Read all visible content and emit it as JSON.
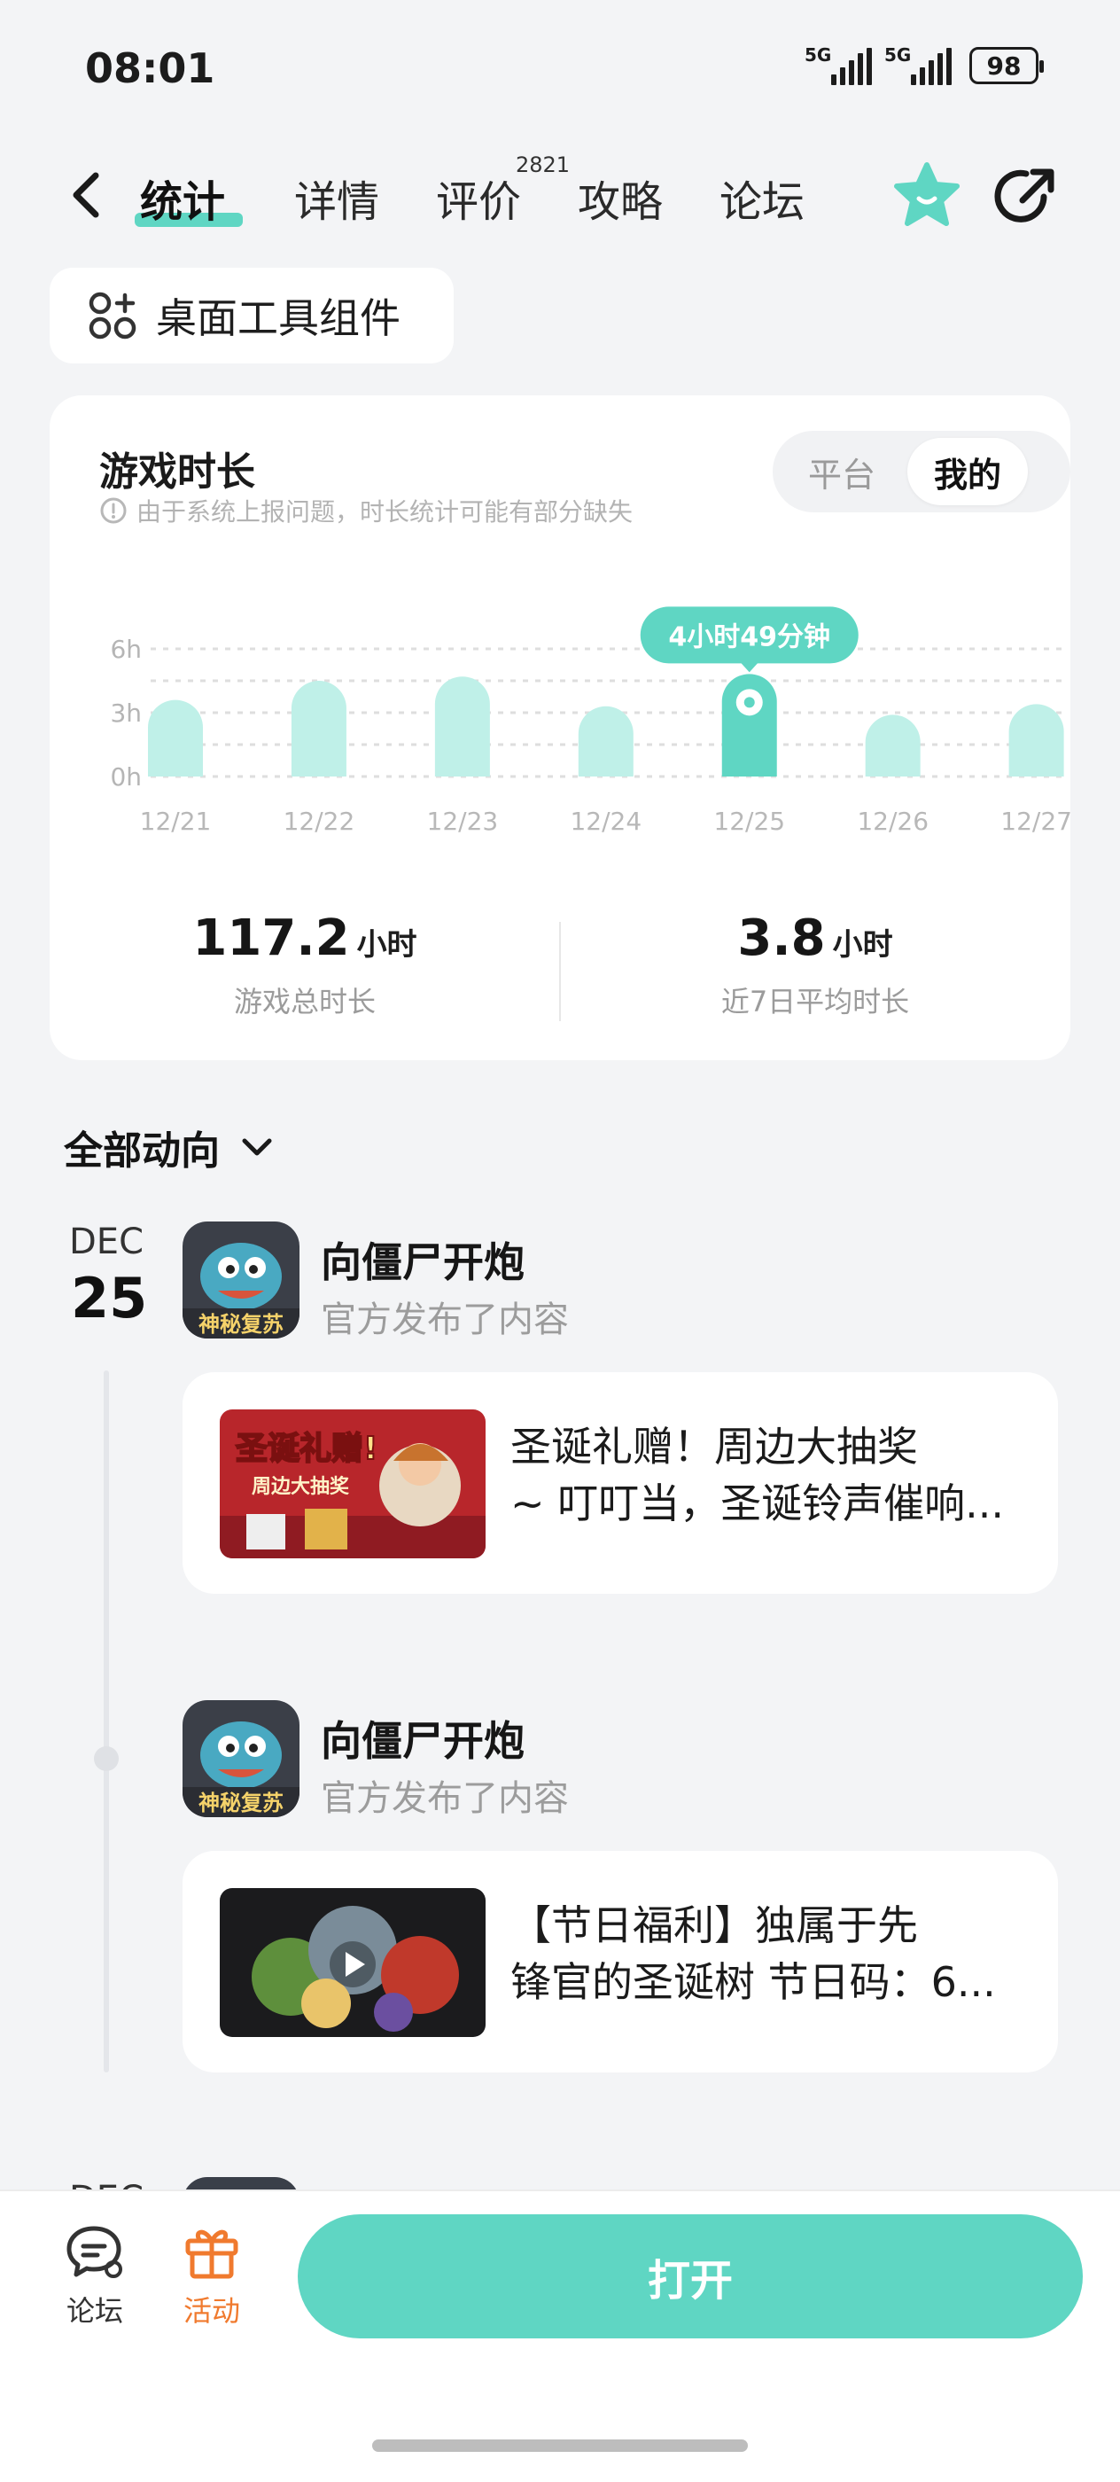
{
  "status_bar": {
    "time": "08:01",
    "net1": "5G",
    "net2": "5G",
    "battery": "98"
  },
  "header": {
    "tabs": [
      {
        "label": "统计",
        "active": true
      },
      {
        "label": "详情",
        "active": false
      },
      {
        "label": "评价",
        "active": false
      },
      {
        "label": "攻略",
        "active": false
      },
      {
        "label": "论坛",
        "active": false
      }
    ],
    "review_count": "2821",
    "icons": [
      "back-icon",
      "star-icon",
      "share-icon"
    ]
  },
  "widget_button": {
    "label": "桌面工具组件",
    "icon": "widget-grid-icon"
  },
  "stats_card": {
    "title": "游戏时长",
    "note": "由于系统上报问题，时长统计可能有部分缺失",
    "toggle": {
      "option_platform": "平台",
      "option_mine": "我的",
      "selected": "我的"
    },
    "total": {
      "value": "117.2",
      "unit": "小时",
      "label": "游戏总时长"
    },
    "average": {
      "value": "3.8",
      "unit": "小时",
      "label": "近7日平均时长"
    }
  },
  "chart_data": {
    "type": "bar",
    "categories": [
      "12/21",
      "12/22",
      "12/23",
      "12/24",
      "12/25",
      "12/26",
      "12/27"
    ],
    "values": [
      3.6,
      4.5,
      4.7,
      3.3,
      4.82,
      2.9,
      3.4
    ],
    "unit": "h",
    "yticks": [
      "0h",
      "3h",
      "6h"
    ],
    "ylim": [
      0,
      6
    ],
    "highlight_index": 4,
    "highlight_label": "4小时49分钟",
    "grid": true,
    "colors": {
      "bar": "#bff0e8",
      "highlight": "#5fd6c3",
      "grid": "#dedede"
    }
  },
  "feed": {
    "filter_label": "全部动向",
    "date": {
      "month": "DEC",
      "day": "25"
    },
    "posts": [
      {
        "app_name": "向僵尸开炮",
        "subtitle": "官方发布了内容",
        "line1": "圣诞礼赠！周边大抽奖",
        "line2": "~ 叮叮当，圣诞铃声催响...",
        "thumb_text": "圣诞礼赠!",
        "thumb_sub": "周边大抽奖"
      },
      {
        "app_name": "向僵尸开炮",
        "subtitle": "官方发布了内容",
        "line1": "【节日福利】独属于先",
        "line2": "锋官的圣诞树 节日码：6...",
        "video": true
      }
    ],
    "next_month": "DEC"
  },
  "bottom_bar": {
    "forum_label": "论坛",
    "activity_label": "活动",
    "open_label": "打开",
    "colors": {
      "activity": "#f07a2e",
      "primary": "#5fd6c3"
    }
  }
}
